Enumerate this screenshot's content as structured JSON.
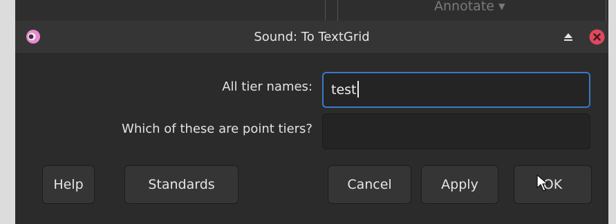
{
  "background": {
    "menu_label": "Annotate ▾"
  },
  "dialog": {
    "title": "Sound: To TextGrid",
    "fields": [
      {
        "label": "All tier names:",
        "value": "test",
        "focused": true
      },
      {
        "label": "Which of these are point tiers?",
        "value": "",
        "focused": false
      }
    ],
    "buttons": {
      "help": "Help",
      "standards": "Standards",
      "cancel": "Cancel",
      "apply": "Apply",
      "ok": "OK"
    },
    "icons": {
      "app": "praat-app-icon",
      "shade": "eject-up-icon",
      "close": "close-icon"
    },
    "colors": {
      "focus_border": "#3a79c9",
      "close_button": "#e0485b",
      "app_icon": "#e58ad0"
    }
  }
}
